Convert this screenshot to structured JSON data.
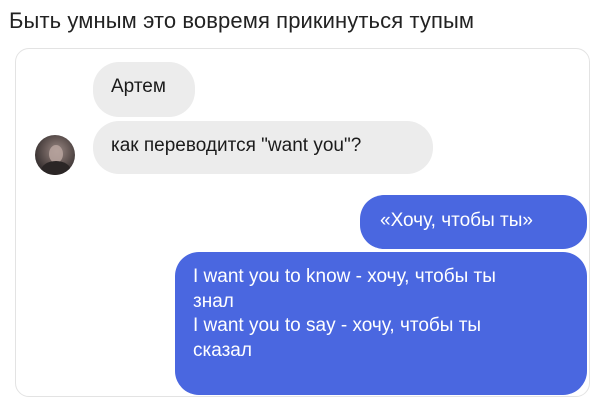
{
  "caption": "Быть умным это вовремя прикинуться тупым",
  "chat": {
    "sender_name": "Артем",
    "incoming_message": "как переводится \"want you\"?",
    "outgoing_quote": "«Хочу, чтобы ты»",
    "outgoing_answer_lines": [
      "I want you to know - хочу, чтобы ты",
      "знал",
      "I want you to say - хочу, чтобы ты",
      "сказал"
    ]
  },
  "colors": {
    "incoming_bubble": "#ececec",
    "outgoing_bubble": "#4a67e0"
  }
}
